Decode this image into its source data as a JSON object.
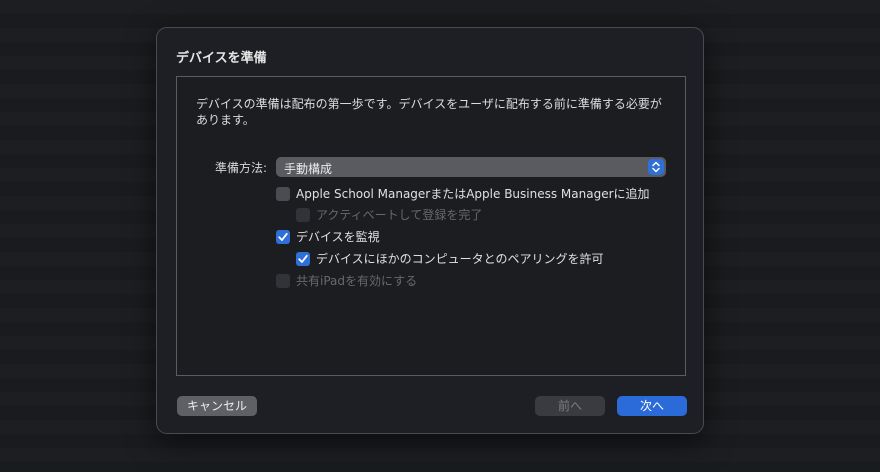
{
  "dialog": {
    "title": "デバイスを準備",
    "description": "デバイスの準備は配布の第一歩です。デバイスをユーザに配布する前に準備する必要があります。",
    "method": {
      "label": "準備方法:",
      "selected": "手動構成"
    },
    "options": [
      {
        "label": "Apple School ManagerまたはApple Business Managerに追加",
        "checked": false,
        "enabled": true
      },
      {
        "label": "アクティベートして登録を完了",
        "checked": false,
        "enabled": false
      },
      {
        "label": "デバイスを監視",
        "checked": true,
        "enabled": true
      },
      {
        "label": "デバイスにほかのコンピュータとのペアリングを許可",
        "checked": true,
        "enabled": true
      },
      {
        "label": "共有iPadを有効にする",
        "checked": false,
        "enabled": false
      }
    ],
    "buttons": {
      "cancel": "キャンセル",
      "previous": "前へ",
      "next": "次へ"
    }
  },
  "colors": {
    "accent": "#2f6fd8",
    "sheet_background": "#1e1f24",
    "disabled_text": "#67686d"
  }
}
